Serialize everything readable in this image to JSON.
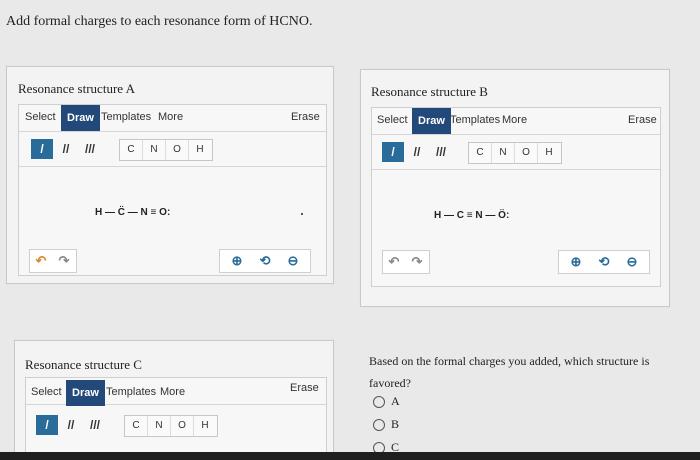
{
  "prompt": "Add formal charges to each resonance form of HCNO.",
  "toolbar": {
    "select": "Select",
    "draw": "Draw",
    "templates": "Templates",
    "more": "More",
    "erase": "Erase"
  },
  "bonds": [
    "/",
    "//",
    "///"
  ],
  "atoms": [
    "C",
    "N",
    "O",
    "H"
  ],
  "structA": {
    "title": "Resonance structure A",
    "molecule": "H — C̈ — N ≡ O:"
  },
  "structB": {
    "title": "Resonance structure B",
    "molecule": "H — C ≡ N — Ö:"
  },
  "structC": {
    "title": "Resonance structure C"
  },
  "question": {
    "text": "Based on the formal charges you added, which structure is favored?",
    "options": [
      "A",
      "B",
      "C"
    ]
  },
  "icons": {
    "undo": "undo-icon",
    "redo": "redo-icon",
    "zoom_in": "zoom-in-icon",
    "reset": "reset-zoom-icon",
    "zoom_out": "zoom-out-icon"
  }
}
